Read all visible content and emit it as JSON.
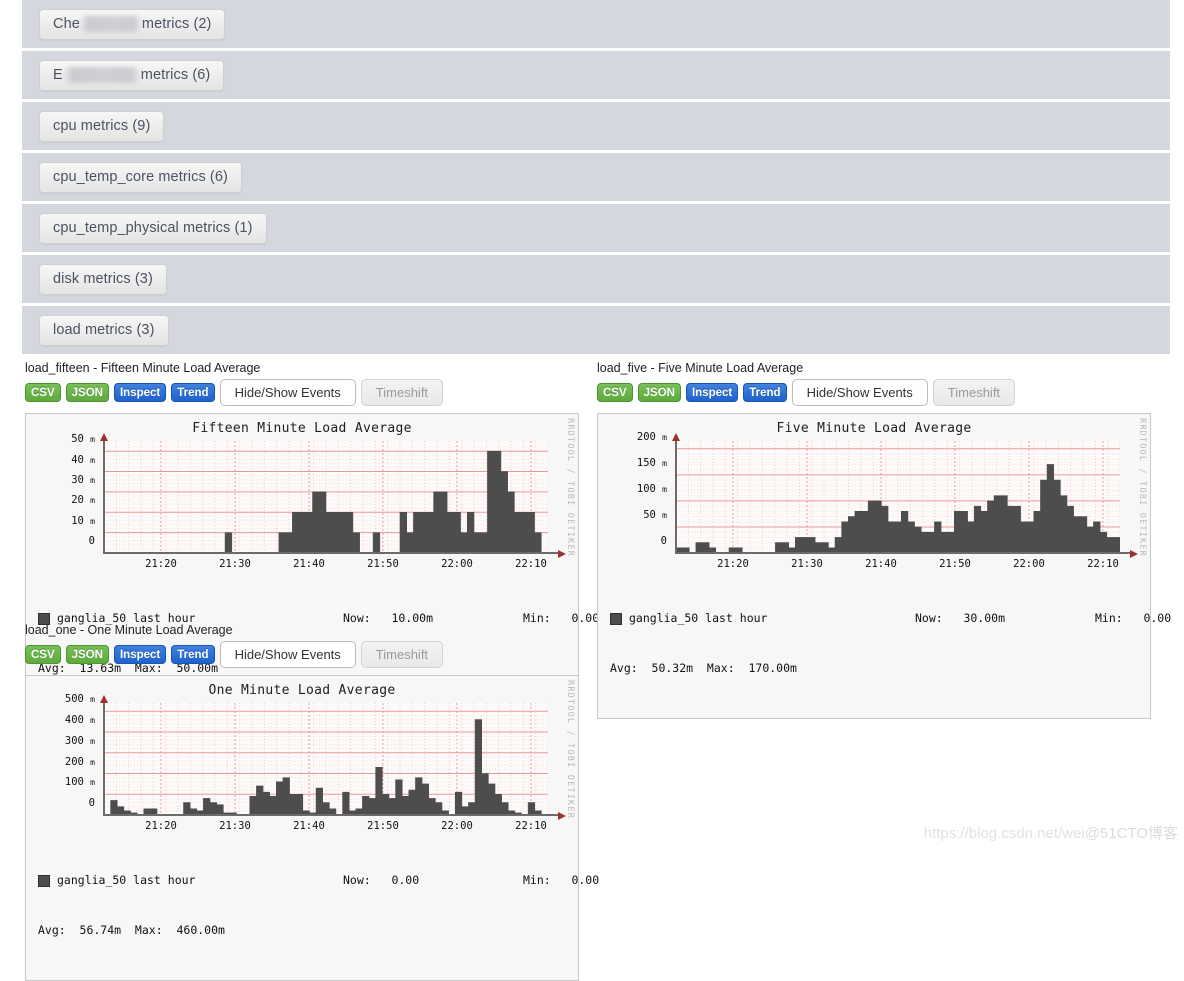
{
  "accordion": {
    "items": [
      {
        "label": "Che",
        "redacted": true,
        "redacted_width": 62,
        "suffix": " metrics (2)",
        "full": "Che█████ metrics (2)"
      },
      {
        "label": "E",
        "redacted": true,
        "redacted_width": 78,
        "suffix": " metrics (6)",
        "full": "E██████ metrics (6)"
      },
      {
        "label": "cpu metrics (9)",
        "redacted": false
      },
      {
        "label": "cpu_temp_core metrics (6)",
        "redacted": false
      },
      {
        "label": "cpu_temp_physical metrics (1)",
        "redacted": false
      },
      {
        "label": "disk metrics (3)",
        "redacted": false
      },
      {
        "label": "load metrics (3)",
        "redacted": false
      }
    ]
  },
  "toolbar": {
    "csv": "CSV",
    "json": "JSON",
    "inspect": "Inspect",
    "trend": "Trend",
    "events": "Hide/Show Events",
    "timeshift": "Timeshift"
  },
  "graphs": [
    {
      "header": "load_fifteen - Fifteen Minute Load Average",
      "metric": "load_fifteen",
      "legend": {
        "host": "ganglia_50 last hour",
        "now_label": "Now:",
        "now_value": "10.00m",
        "min_label": "Min:",
        "min_value": "0.00",
        "avg_label": "Avg:",
        "avg_value": "13.63m",
        "max_label": "Max:",
        "max_value": "50.00m"
      }
    },
    {
      "header": "load_five - Five Minute Load Average",
      "metric": "load_five",
      "legend": {
        "host": "ganglia_50 last hour",
        "now_label": "Now:",
        "now_value": "30.00m",
        "min_label": "Min:",
        "min_value": "0.00",
        "avg_label": "Avg:",
        "avg_value": "50.32m",
        "max_label": "Max:",
        "max_value": "170.00m"
      }
    },
    {
      "header": "load_one - One Minute Load Average",
      "metric": "load_one",
      "legend": {
        "host": "ganglia_50 last hour",
        "now_label": "Now:",
        "now_value": "0.00",
        "min_label": "Min:",
        "min_value": "0.00",
        "avg_label": "Avg:",
        "avg_value": "56.74m",
        "max_label": "Max:",
        "max_value": "460.00m"
      }
    }
  ],
  "rrd_watermark": "RRDTOOL / TOBI OETIKER",
  "page_watermark": {
    "url": "https://blog.csdn.net/wei",
    "brand": "@51CTO博客"
  },
  "colors": {
    "accent_green": "#5faa3f",
    "accent_blue": "#1f61cb",
    "area_fill": "#4d4d4d",
    "grid": "#e8a0a0",
    "row_band": "#d4d8de",
    "plot_bg": "#fffafa"
  },
  "chart_data": [
    {
      "type": "area",
      "title": "Fifteen Minute Load Average",
      "xlabel": "",
      "ylabel": "",
      "ylim": [
        0,
        55
      ],
      "yticks": [
        0,
        10,
        20,
        30,
        40,
        50
      ],
      "ytick_labels": [
        "0",
        "10 m",
        "20 m",
        "30 m",
        "40 m",
        "50 m"
      ],
      "xticks": [
        "21:20",
        "21:30",
        "21:40",
        "21:50",
        "22:00",
        "22:10"
      ],
      "grid": true,
      "legend_position": "below",
      "series": [
        {
          "name": "ganglia_50 last hour",
          "color": "#4d4d4d",
          "values": [
            0,
            0,
            0,
            0,
            0,
            0,
            0,
            0,
            0,
            0,
            0,
            0,
            0,
            0,
            0,
            0,
            0,
            0,
            10,
            0,
            0,
            0,
            0,
            0,
            0,
            0,
            10,
            10,
            20,
            20,
            20,
            30,
            30,
            20,
            20,
            20,
            20,
            10,
            0,
            0,
            10,
            0,
            0,
            0,
            20,
            10,
            20,
            20,
            20,
            30,
            30,
            20,
            20,
            10,
            20,
            10,
            10,
            50,
            50,
            40,
            30,
            20,
            20,
            20,
            10,
            0
          ]
        }
      ]
    },
    {
      "type": "area",
      "title": "Five Minute Load Average",
      "xlabel": "",
      "ylabel": "",
      "ylim": [
        0,
        215
      ],
      "yticks": [
        0,
        50,
        100,
        150,
        200
      ],
      "ytick_labels": [
        "0",
        "50 m",
        "100 m",
        "150 m",
        "200 m"
      ],
      "xticks": [
        "21:20",
        "21:30",
        "21:40",
        "21:50",
        "22:00",
        "22:10"
      ],
      "grid": true,
      "legend_position": "below",
      "series": [
        {
          "name": "ganglia_50 last hour",
          "color": "#4d4d4d",
          "values": [
            10,
            10,
            0,
            20,
            20,
            10,
            0,
            0,
            10,
            10,
            0,
            0,
            0,
            0,
            0,
            20,
            20,
            10,
            30,
            30,
            30,
            20,
            20,
            10,
            30,
            60,
            70,
            80,
            80,
            100,
            100,
            90,
            60,
            60,
            80,
            60,
            50,
            40,
            40,
            60,
            40,
            40,
            80,
            80,
            60,
            90,
            80,
            100,
            110,
            110,
            90,
            90,
            60,
            60,
            80,
            140,
            170,
            140,
            110,
            90,
            70,
            70,
            50,
            60,
            40,
            30,
            30
          ]
        }
      ]
    },
    {
      "type": "area",
      "title": "One Minute Load Average",
      "xlabel": "",
      "ylabel": "",
      "ylim": [
        0,
        540
      ],
      "yticks": [
        0,
        100,
        200,
        300,
        400,
        500
      ],
      "ytick_labels": [
        "0",
        "100 m",
        "200 m",
        "300 m",
        "400 m",
        "500 m"
      ],
      "xticks": [
        "21:20",
        "21:30",
        "21:40",
        "21:50",
        "22:00",
        "22:10"
      ],
      "grid": true,
      "legend_position": "below",
      "series": [
        {
          "name": "ganglia_50 last hour",
          "color": "#4d4d4d",
          "values": [
            0,
            70,
            40,
            20,
            10,
            0,
            30,
            30,
            0,
            0,
            0,
            0,
            60,
            30,
            20,
            80,
            60,
            50,
            10,
            10,
            0,
            0,
            90,
            140,
            110,
            90,
            160,
            180,
            100,
            100,
            20,
            10,
            130,
            60,
            30,
            0,
            110,
            20,
            30,
            90,
            80,
            230,
            100,
            80,
            170,
            90,
            120,
            180,
            150,
            80,
            60,
            20,
            0,
            110,
            40,
            60,
            460,
            200,
            150,
            100,
            60,
            20,
            10,
            0,
            60,
            20,
            0
          ]
        }
      ]
    }
  ]
}
